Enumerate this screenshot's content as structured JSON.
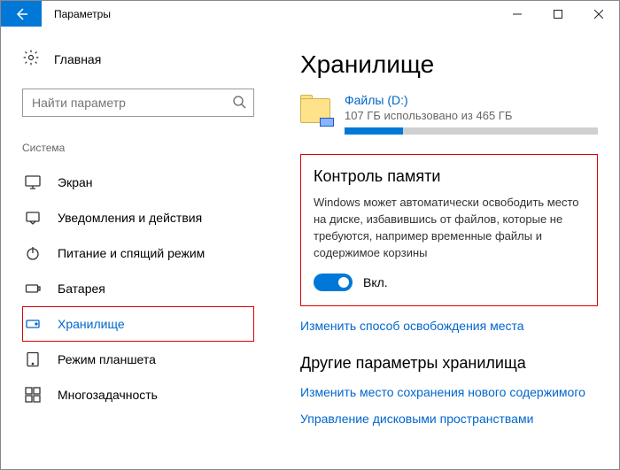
{
  "window": {
    "title": "Параметры"
  },
  "sidebar": {
    "home": "Главная",
    "search_placeholder": "Найти параметр",
    "section_label": "Система",
    "items": [
      {
        "label": "Экран"
      },
      {
        "label": "Уведомления и действия"
      },
      {
        "label": "Питание и спящий режим"
      },
      {
        "label": "Батарея"
      },
      {
        "label": "Хранилище"
      },
      {
        "label": "Режим планшета"
      },
      {
        "label": "Многозадачность"
      }
    ]
  },
  "page": {
    "title": "Хранилище",
    "drive": {
      "name": "Файлы (D:)",
      "usage_text": "107 ГБ использовано из 465 ГБ",
      "used_gb": 107,
      "total_gb": 465,
      "bar_percent": 23
    },
    "storage_sense": {
      "heading": "Контроль памяти",
      "description": "Windows может автоматически освободить место на диске, избавившись от файлов, которые не требуются, например временные файлы и содержимое корзины",
      "toggle_on": true,
      "toggle_label": "Вкл."
    },
    "change_link": "Изменить способ освобождения места",
    "other_heading": "Другие параметры хранилища",
    "other_links": [
      "Изменить место сохранения нового содержимого",
      "Управление дисковыми пространствами"
    ]
  }
}
